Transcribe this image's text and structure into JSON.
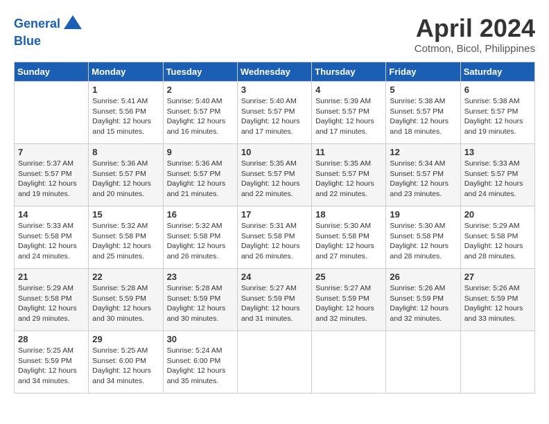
{
  "header": {
    "logo_line1": "General",
    "logo_line2": "Blue",
    "month_year": "April 2024",
    "location": "Cotmon, Bicol, Philippines"
  },
  "days_of_week": [
    "Sunday",
    "Monday",
    "Tuesday",
    "Wednesday",
    "Thursday",
    "Friday",
    "Saturday"
  ],
  "weeks": [
    [
      {
        "num": "",
        "info": ""
      },
      {
        "num": "1",
        "info": "Sunrise: 5:41 AM\nSunset: 5:56 PM\nDaylight: 12 hours\nand 15 minutes."
      },
      {
        "num": "2",
        "info": "Sunrise: 5:40 AM\nSunset: 5:57 PM\nDaylight: 12 hours\nand 16 minutes."
      },
      {
        "num": "3",
        "info": "Sunrise: 5:40 AM\nSunset: 5:57 PM\nDaylight: 12 hours\nand 17 minutes."
      },
      {
        "num": "4",
        "info": "Sunrise: 5:39 AM\nSunset: 5:57 PM\nDaylight: 12 hours\nand 17 minutes."
      },
      {
        "num": "5",
        "info": "Sunrise: 5:38 AM\nSunset: 5:57 PM\nDaylight: 12 hours\nand 18 minutes."
      },
      {
        "num": "6",
        "info": "Sunrise: 5:38 AM\nSunset: 5:57 PM\nDaylight: 12 hours\nand 19 minutes."
      }
    ],
    [
      {
        "num": "7",
        "info": "Sunrise: 5:37 AM\nSunset: 5:57 PM\nDaylight: 12 hours\nand 19 minutes."
      },
      {
        "num": "8",
        "info": "Sunrise: 5:36 AM\nSunset: 5:57 PM\nDaylight: 12 hours\nand 20 minutes."
      },
      {
        "num": "9",
        "info": "Sunrise: 5:36 AM\nSunset: 5:57 PM\nDaylight: 12 hours\nand 21 minutes."
      },
      {
        "num": "10",
        "info": "Sunrise: 5:35 AM\nSunset: 5:57 PM\nDaylight: 12 hours\nand 22 minutes."
      },
      {
        "num": "11",
        "info": "Sunrise: 5:35 AM\nSunset: 5:57 PM\nDaylight: 12 hours\nand 22 minutes."
      },
      {
        "num": "12",
        "info": "Sunrise: 5:34 AM\nSunset: 5:57 PM\nDaylight: 12 hours\nand 23 minutes."
      },
      {
        "num": "13",
        "info": "Sunrise: 5:33 AM\nSunset: 5:57 PM\nDaylight: 12 hours\nand 24 minutes."
      }
    ],
    [
      {
        "num": "14",
        "info": "Sunrise: 5:33 AM\nSunset: 5:58 PM\nDaylight: 12 hours\nand 24 minutes."
      },
      {
        "num": "15",
        "info": "Sunrise: 5:32 AM\nSunset: 5:58 PM\nDaylight: 12 hours\nand 25 minutes."
      },
      {
        "num": "16",
        "info": "Sunrise: 5:32 AM\nSunset: 5:58 PM\nDaylight: 12 hours\nand 26 minutes."
      },
      {
        "num": "17",
        "info": "Sunrise: 5:31 AM\nSunset: 5:58 PM\nDaylight: 12 hours\nand 26 minutes."
      },
      {
        "num": "18",
        "info": "Sunrise: 5:30 AM\nSunset: 5:58 PM\nDaylight: 12 hours\nand 27 minutes."
      },
      {
        "num": "19",
        "info": "Sunrise: 5:30 AM\nSunset: 5:58 PM\nDaylight: 12 hours\nand 28 minutes."
      },
      {
        "num": "20",
        "info": "Sunrise: 5:29 AM\nSunset: 5:58 PM\nDaylight: 12 hours\nand 28 minutes."
      }
    ],
    [
      {
        "num": "21",
        "info": "Sunrise: 5:29 AM\nSunset: 5:58 PM\nDaylight: 12 hours\nand 29 minutes."
      },
      {
        "num": "22",
        "info": "Sunrise: 5:28 AM\nSunset: 5:59 PM\nDaylight: 12 hours\nand 30 minutes."
      },
      {
        "num": "23",
        "info": "Sunrise: 5:28 AM\nSunset: 5:59 PM\nDaylight: 12 hours\nand 30 minutes."
      },
      {
        "num": "24",
        "info": "Sunrise: 5:27 AM\nSunset: 5:59 PM\nDaylight: 12 hours\nand 31 minutes."
      },
      {
        "num": "25",
        "info": "Sunrise: 5:27 AM\nSunset: 5:59 PM\nDaylight: 12 hours\nand 32 minutes."
      },
      {
        "num": "26",
        "info": "Sunrise: 5:26 AM\nSunset: 5:59 PM\nDaylight: 12 hours\nand 32 minutes."
      },
      {
        "num": "27",
        "info": "Sunrise: 5:26 AM\nSunset: 5:59 PM\nDaylight: 12 hours\nand 33 minutes."
      }
    ],
    [
      {
        "num": "28",
        "info": "Sunrise: 5:25 AM\nSunset: 5:59 PM\nDaylight: 12 hours\nand 34 minutes."
      },
      {
        "num": "29",
        "info": "Sunrise: 5:25 AM\nSunset: 6:00 PM\nDaylight: 12 hours\nand 34 minutes."
      },
      {
        "num": "30",
        "info": "Sunrise: 5:24 AM\nSunset: 6:00 PM\nDaylight: 12 hours\nand 35 minutes."
      },
      {
        "num": "",
        "info": ""
      },
      {
        "num": "",
        "info": ""
      },
      {
        "num": "",
        "info": ""
      },
      {
        "num": "",
        "info": ""
      }
    ]
  ]
}
